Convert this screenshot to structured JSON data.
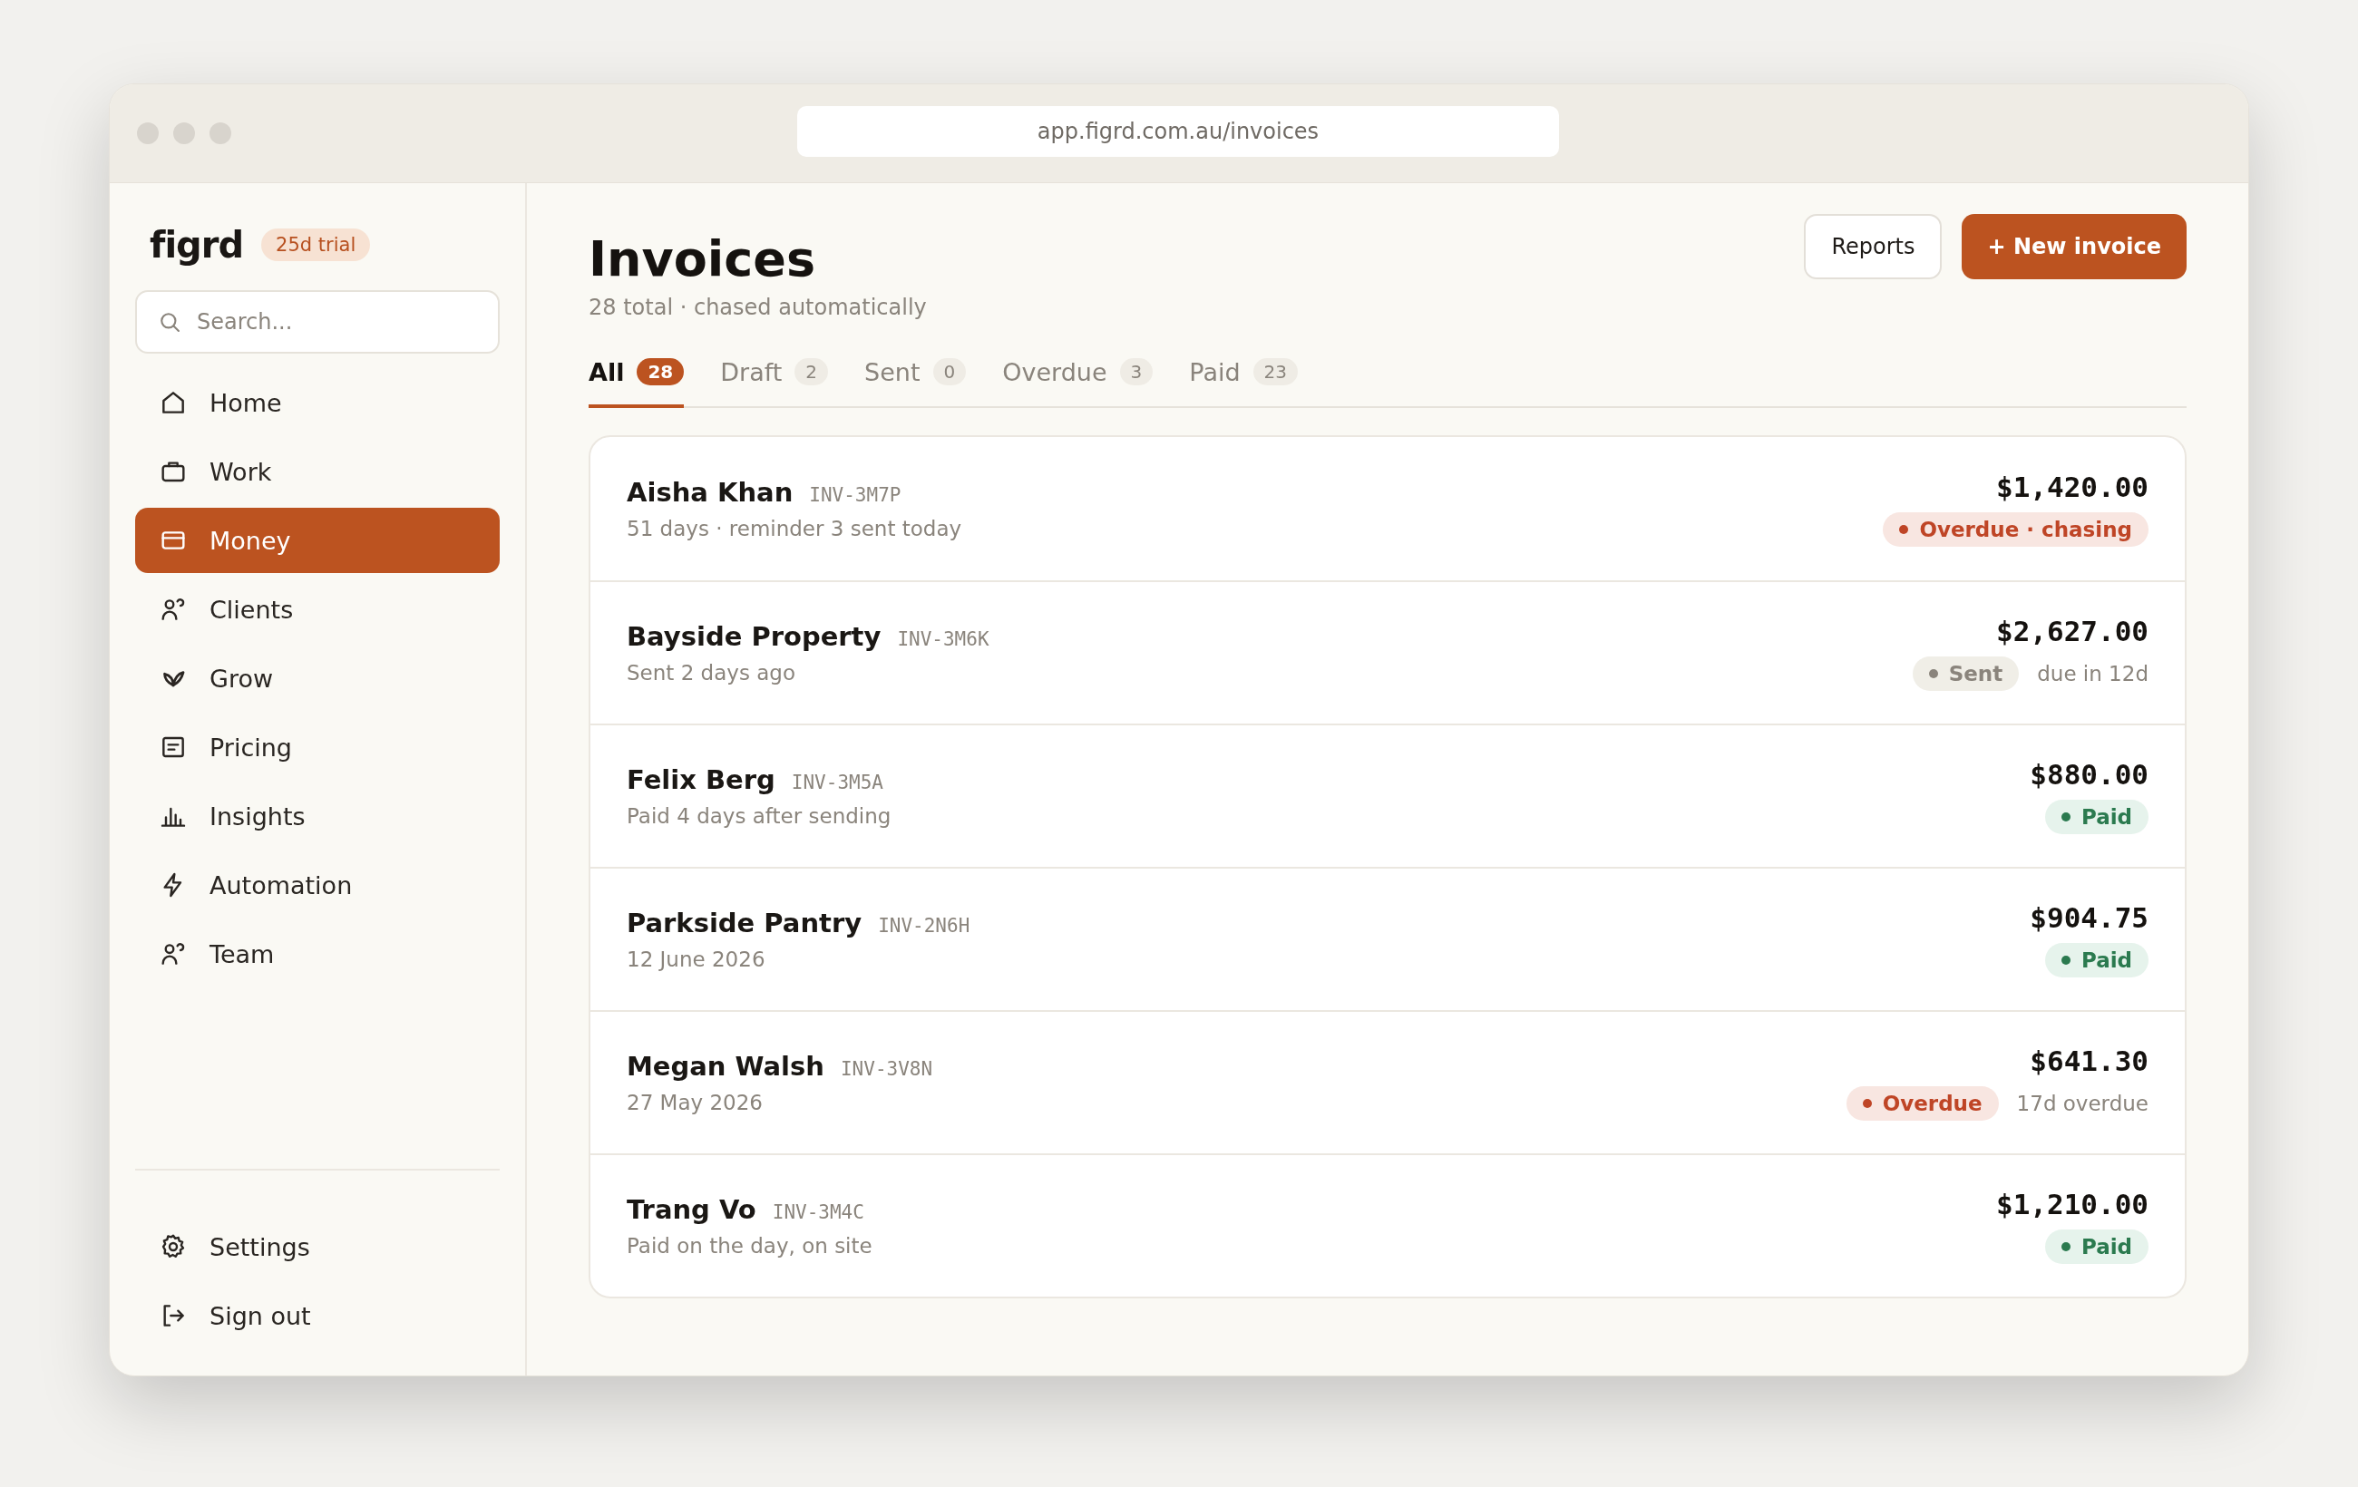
{
  "browser": {
    "url": "app.figrd.com.au/invoices"
  },
  "sidebar": {
    "logo": "figrd",
    "trial_badge": "25d trial",
    "search": {
      "placeholder": "Search..."
    },
    "items": [
      {
        "label": "Home",
        "selected": false
      },
      {
        "label": "Work",
        "selected": false
      },
      {
        "label": "Money",
        "selected": true
      },
      {
        "label": "Clients",
        "selected": false
      },
      {
        "label": "Grow",
        "selected": false
      },
      {
        "label": "Pricing",
        "selected": false
      },
      {
        "label": "Insights",
        "selected": false
      },
      {
        "label": "Automation",
        "selected": false
      },
      {
        "label": "Team",
        "selected": false
      }
    ],
    "footer_items": [
      {
        "label": "Settings"
      },
      {
        "label": "Sign out"
      }
    ]
  },
  "header": {
    "title": "Invoices",
    "subtitle": "28 total · chased automatically",
    "buttons": [
      {
        "label": "Reports",
        "kind": "secondary"
      },
      {
        "label": "+ New invoice",
        "kind": "primary"
      }
    ]
  },
  "tabs": [
    {
      "label": "All",
      "count": "28",
      "selected": true
    },
    {
      "label": "Draft",
      "count": "2",
      "selected": false
    },
    {
      "label": "Sent",
      "count": "0",
      "selected": false
    },
    {
      "label": "Overdue",
      "count": "3",
      "selected": false
    },
    {
      "label": "Paid",
      "count": "23",
      "selected": false
    }
  ],
  "invoices": [
    {
      "client": "Aisha Khan",
      "number": "INV-3M7P",
      "detail": "51 days · reminder 3 sent today",
      "amount": "$1,420.00",
      "kind": "overdue",
      "status_label": "Overdue · chasing"
    },
    {
      "client": "Bayside Property",
      "number": "INV-3M6K",
      "detail": "Sent 2 days ago",
      "amount": "$2,627.00",
      "kind": "sent",
      "status_label": "Sent",
      "note": "due in 12d"
    },
    {
      "client": "Felix Berg",
      "number": "INV-3M5A",
      "detail": "Paid 4 days after sending",
      "amount": "$880.00",
      "kind": "paid",
      "status_label": "Paid"
    },
    {
      "client": "Parkside Pantry",
      "number": "INV-2N6H",
      "detail": "12 June 2026",
      "amount": "$904.75",
      "kind": "paid",
      "status_label": "Paid"
    },
    {
      "client": "Megan Walsh",
      "number": "INV-3V8N",
      "detail": "27 May 2026",
      "amount": "$641.30",
      "kind": "overdue",
      "status_label": "Overdue",
      "note": "17d overdue"
    },
    {
      "client": "Trang Vo",
      "number": "INV-3M4C",
      "detail": "Paid on the day, on site",
      "amount": "$1,210.00",
      "kind": "paid",
      "status_label": "Paid"
    }
  ]
}
